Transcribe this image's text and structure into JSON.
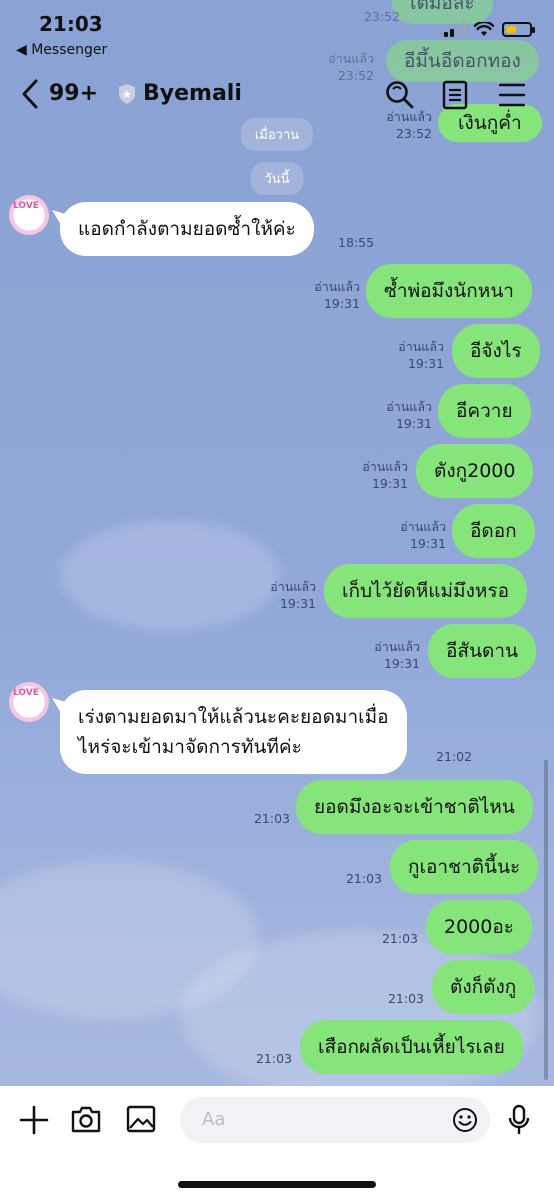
{
  "status": {
    "time": "21:03",
    "back_app": "◀ Messenger"
  },
  "header": {
    "unread_count": "99+",
    "chat_name": "Byemali"
  },
  "peeking_messages": {
    "top1": "เต็มอละ",
    "top1_time": "23:52",
    "top2": "อีมึ้นอีดอกทอง",
    "top2_read": "อ่านแล้ว",
    "top2_time": "23:52",
    "top3": "เงินกูค่ำ",
    "top3_read": "อ่านแล้ว",
    "top3_time": "23:52"
  },
  "dates": {
    "yesterday": "เมื่อวาน",
    "today": "วันนี้"
  },
  "messages": [
    {
      "dir": "in",
      "text": "แอดกำลังตามยอดซ้ำให้ค่ะ",
      "time": "18:55"
    },
    {
      "dir": "out",
      "text": "ซ้ำพ่อมึงนักหนา",
      "read": "อ่านแล้ว",
      "time": "19:31"
    },
    {
      "dir": "out",
      "text": "อีจังไร",
      "read": "อ่านแล้ว",
      "time": "19:31"
    },
    {
      "dir": "out",
      "text": "อีควาย",
      "read": "อ่านแล้ว",
      "time": "19:31"
    },
    {
      "dir": "out",
      "text": "ตังกู2000",
      "read": "อ่านแล้ว",
      "time": "19:31"
    },
    {
      "dir": "out",
      "text": "อีดอก",
      "read": "อ่านแล้ว",
      "time": "19:31"
    },
    {
      "dir": "out",
      "text": "เก็บไว้ยัดหีแม่มึงหรอ",
      "read": "อ่านแล้ว",
      "time": "19:31"
    },
    {
      "dir": "out",
      "text": "อีสันดาน",
      "read": "อ่านแล้ว",
      "time": "19:31"
    },
    {
      "dir": "in",
      "line1": "เร่งตามยอดมาให้แล้วนะคะยอดมาเมื่อ",
      "line2": "ไหร่จะเข้ามาจัดการทันทีค่ะ",
      "time": "21:02"
    },
    {
      "dir": "out",
      "text": "ยอดมึงอะจะเข้าชาติไหน",
      "time": "21:03"
    },
    {
      "dir": "out",
      "text": "กูเอาชาตินี้นะ",
      "time": "21:03"
    },
    {
      "dir": "out",
      "text": "2000อะ",
      "time": "21:03"
    },
    {
      "dir": "out",
      "text": "ตังก็ตังกู",
      "time": "21:03"
    },
    {
      "dir": "out",
      "text": "เสือกผลัดเป็นเหี้ยไรเลย",
      "time": "21:03"
    }
  ],
  "avatar_text": "LOVE",
  "input": {
    "placeholder": "Aa"
  },
  "colors": {
    "outgoing_bubble": "#86e57a",
    "incoming_bubble": "#ffffff",
    "chat_background": "#8fa6d6"
  },
  "icons": {
    "header": [
      "chevron-left-icon",
      "shield-icon",
      "search-icon",
      "notes-icon",
      "menu-icon"
    ],
    "inputbar": [
      "plus-icon",
      "camera-icon",
      "image-icon",
      "emoji-icon",
      "microphone-icon"
    ]
  }
}
